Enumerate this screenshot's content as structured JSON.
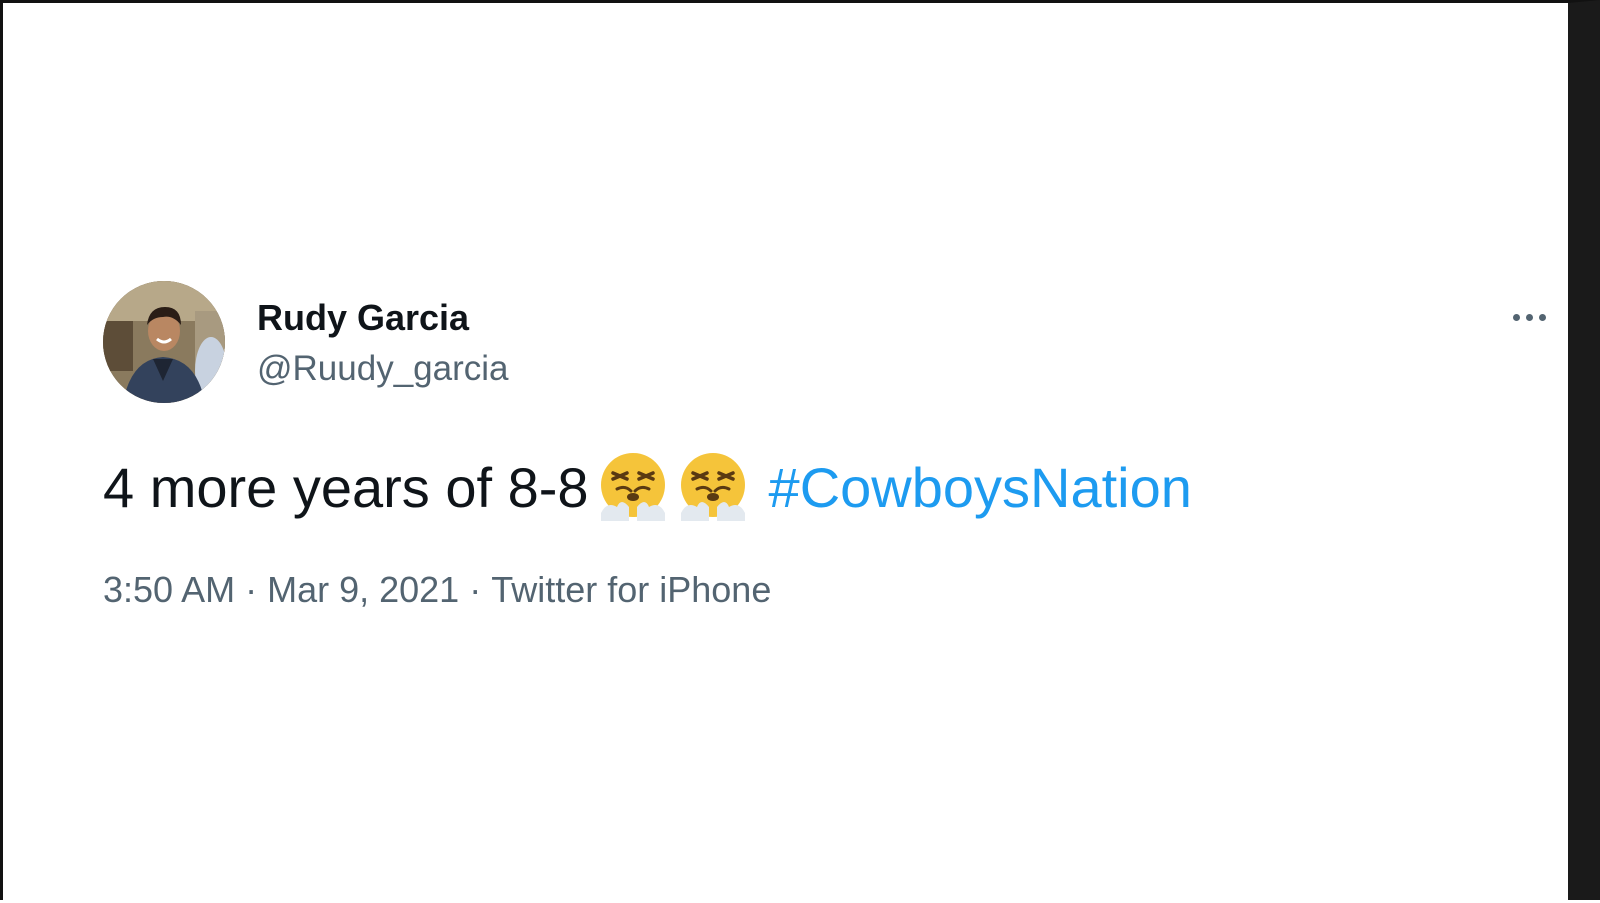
{
  "author": {
    "display_name": "Rudy Garcia",
    "handle": "@Ruudy_garcia",
    "avatar_icon": "profile-photo"
  },
  "tweet": {
    "text": "4 more years of 8-8",
    "emojis": [
      "face-with-steam-from-nose",
      "face-with-steam-from-nose"
    ],
    "hashtag": "#CowboysNation",
    "time": "3:50 AM",
    "separator": "·",
    "date": "Mar 9, 2021",
    "source": "Twitter for iPhone"
  },
  "menu": {
    "icon": "more-horizontal-icon"
  },
  "colors": {
    "text": "#0f1419",
    "muted": "#536471",
    "link": "#1d9bf0",
    "emoji": "#f5c43a"
  }
}
